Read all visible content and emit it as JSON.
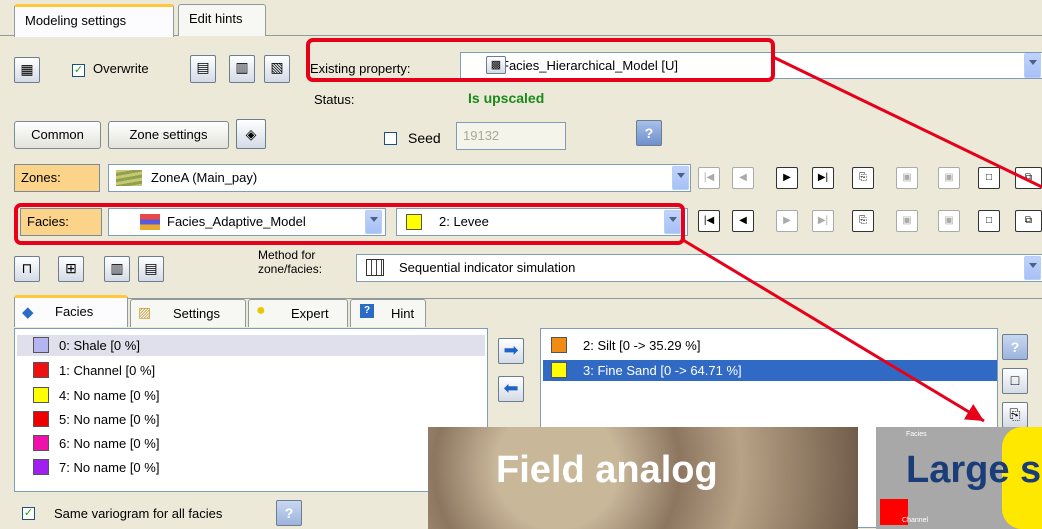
{
  "tabs": [
    "Modeling settings",
    "Edit hints"
  ],
  "top": {
    "overwrite_label": "Overwrite",
    "existing_property_label": "Existing property:",
    "existing_property_value": "Facies_Hierarchical_Model [U]",
    "status_label": "Status:",
    "status_value": "Is upscaled"
  },
  "row2": {
    "common_label": "Common",
    "zone_settings_label": "Zone settings",
    "seed_label": "Seed",
    "seed_value": "19132"
  },
  "zones": {
    "label": "Zones:",
    "value": "ZoneA (Main_pay)"
  },
  "facies": {
    "label": "Facies:",
    "model_value": "Facies_Adaptive_Model",
    "selected_value": "2: Levee"
  },
  "method": {
    "label_line1": "Method for",
    "label_line2": "zone/facies:",
    "value": "Sequential indicator simulation"
  },
  "subtabs": [
    "Facies",
    "Settings",
    "Expert",
    "Hint"
  ],
  "left_list": [
    {
      "label": "0: Shale [0 %]",
      "color": "#b4b4f0"
    },
    {
      "label": "1: Channel [0 %]",
      "color": "#ee1111"
    },
    {
      "label": "4: No name [0 %]",
      "color": "#ffff00"
    },
    {
      "label": "5: No name [0 %]",
      "color": "#ee0000"
    },
    {
      "label": "6: No name [0 %]",
      "color": "#ee11aa"
    },
    {
      "label": "7: No name [0 %]",
      "color": "#a020f0"
    }
  ],
  "right_list": [
    {
      "label": "2: Silt [0 -> 35.29 %]",
      "color": "#f08c14"
    },
    {
      "label": "3: Fine Sand [0 -> 64.71 %]",
      "color": "#ffff00"
    }
  ],
  "same_variogram_label": "Same variogram for all facies",
  "overlays": {
    "field_analog": "Field analog",
    "large_prefix": "Large s",
    "facies_small": "Facies",
    "channel_small": "Channel"
  },
  "colors": {
    "accent_red": "#e6001a",
    "status_green": "#1a8a1a",
    "selection_blue": "#316ac5"
  }
}
